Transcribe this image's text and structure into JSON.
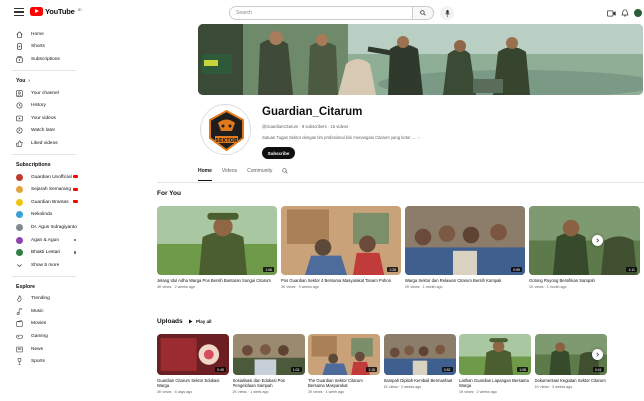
{
  "topbar": {
    "logo_text": "YouTube",
    "logo_region": "ID",
    "search_placeholder": "Search"
  },
  "sidebar": {
    "main": [
      {
        "label": "Home",
        "icon": "home-icon"
      },
      {
        "label": "Shorts",
        "icon": "shorts-icon"
      },
      {
        "label": "Subscriptions",
        "icon": "subscriptions-icon"
      }
    ],
    "you_heading": "You",
    "you": [
      {
        "label": "Your channel",
        "icon": "channel-icon"
      },
      {
        "label": "History",
        "icon": "history-icon"
      },
      {
        "label": "Your videos",
        "icon": "videos-icon"
      },
      {
        "label": "Watch later",
        "icon": "clock-icon"
      },
      {
        "label": "Liked videos",
        "icon": "thumb-up-icon"
      }
    ],
    "subscriptions_heading": "Subscriptions",
    "subscriptions": [
      {
        "label": "Guardian Unofficial",
        "color": "#c0392b",
        "live": true
      },
      {
        "label": "Sejarah Semarang",
        "color": "#e6a23c",
        "live": true
      },
      {
        "label": "Guardian Brantas",
        "color": "#f1c40f",
        "live": true
      },
      {
        "label": "Nekolindo",
        "color": "#3aa0d8",
        "live": false
      },
      {
        "label": "Dr. Agus Indragiyanto",
        "color": "#7f8c8d",
        "live": false
      },
      {
        "label": "Agan & Agun",
        "color": "#8e44ad",
        "live": false,
        "dot": true
      },
      {
        "label": "Bhakti Lestari",
        "color": "#2d7d46",
        "live": false,
        "dot": true
      }
    ],
    "show_more": "Show 5 more",
    "explore_heading": "Explore",
    "explore": [
      {
        "label": "Trending",
        "icon": "trending-icon"
      },
      {
        "label": "Music",
        "icon": "music-icon"
      },
      {
        "label": "Movies",
        "icon": "movies-icon"
      },
      {
        "label": "Gaming",
        "icon": "gaming-icon"
      },
      {
        "label": "News",
        "icon": "news-icon"
      },
      {
        "label": "Sports",
        "icon": "sports-icon"
      }
    ]
  },
  "channel": {
    "name": "Guardian_Citarum",
    "logo_text": "SEKTOR",
    "meta": "@GuardianCitarum · 8 subscribers · 16 videos",
    "description": "Satuan Tugas Sektor dengan tim profesional kini menangani Citarum yang kotor ...",
    "subscribe_label": "Subscribe"
  },
  "tabs": [
    "Home",
    "Videos",
    "Community"
  ],
  "sections": {
    "for_you": "For You",
    "uploads": "Uploads",
    "play_all": "Play all"
  },
  "for_you_videos": [
    {
      "title": "Jelang Idul Adha Warga Pos Bersih Bantaran Sungai Citarum",
      "meta": "4K views · 2 weeks ago",
      "duration": "1:06",
      "scene": "soldier"
    },
    {
      "title": "Pos Guardian Sektor 4 Bersama Masyarakat Tanam Pohon",
      "meta": "3K views · 3 weeks ago",
      "duration": "1:28",
      "scene": "room"
    },
    {
      "title": "Warga Sektor dan Relawan Citarum Bersih Kompak",
      "meta": "2K views · 1 month ago",
      "duration": "0:59",
      "scene": "crowd"
    },
    {
      "title": "Gotong Royong Bersihkan Sampah",
      "meta": "1K views · 1 month ago",
      "duration": "1:11",
      "scene": "outdoor"
    }
  ],
  "uploads_videos": [
    {
      "title": "Guardian Citarum Sektor Edukasi Warga",
      "meta": "3K views · 4 days ago",
      "duration": "0:45",
      "scene": "red"
    },
    {
      "title": "Sosialisasi dan Edukasi Pos Pengelolaan Sampah",
      "meta": "2K views · 1 week ago",
      "duration": "1:02",
      "scene": "group"
    },
    {
      "title": "The Guardian Sektor Citarum Bersama Masyarakat",
      "meta": "2K views · 1 week ago",
      "duration": "1:15",
      "scene": "room"
    },
    {
      "title": "Sampah Dipilah Kembali Bermanfaat",
      "meta": "1K views · 2 weeks ago",
      "duration": "0:52",
      "scene": "crowd"
    },
    {
      "title": "Latihan Guardian Lapangan Bersama Warga",
      "meta": "1K views · 2 weeks ago",
      "duration": "1:08",
      "scene": "soldier"
    },
    {
      "title": "Dokumentasi Kegiatan Sektor Citarum",
      "meta": "1K views · 3 weeks ago",
      "duration": "0:41",
      "scene": "outdoor"
    }
  ]
}
